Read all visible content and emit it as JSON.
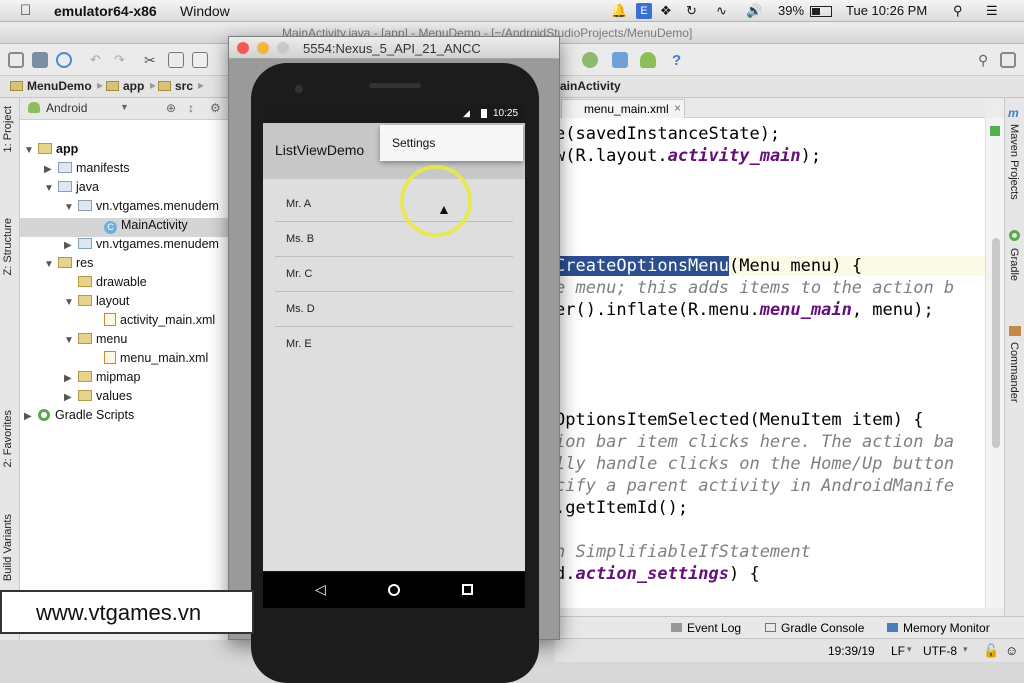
{
  "menubar": {
    "app_name": "emulator64-x86",
    "menu_window": "Window",
    "battery": "39%",
    "clock": "Tue 10:26 PM"
  },
  "studio": {
    "title": "MainActivity.java - [app] - MenuDemo - [~/AndroidStudioProjects/MenuDemo]",
    "breadcrumbs": [
      "MenuDemo",
      "app",
      "src"
    ],
    "crumb_tail": "ainActivity",
    "project_view": "Android",
    "tree": [
      {
        "label": "app",
        "level": 0
      },
      {
        "label": "manifests",
        "level": 1
      },
      {
        "label": "java",
        "level": 1
      },
      {
        "label": "vn.vtgames.menudem",
        "level": 2
      },
      {
        "label": "MainActivity",
        "level": 3
      },
      {
        "label": "vn.vtgames.menudem",
        "level": 2
      },
      {
        "label": "res",
        "level": 1
      },
      {
        "label": "drawable",
        "level": 2
      },
      {
        "label": "layout",
        "level": 2
      },
      {
        "label": "activity_main.xml",
        "level": 3
      },
      {
        "label": "menu",
        "level": 2
      },
      {
        "label": "menu_main.xml",
        "level": 3
      },
      {
        "label": "mipmap",
        "level": 2
      },
      {
        "label": "values",
        "level": 2
      },
      {
        "label": "Gradle Scripts",
        "level": 0
      }
    ],
    "left_tools": [
      "1: Project",
      "Z: Structure",
      "2: Favorites",
      "Build Variants"
    ],
    "right_tools": [
      "Maven Projects",
      "Gradle",
      "Commander"
    ],
    "editor_tab": "menu_main.xml",
    "code": {
      "l1": "e(savedInstanceState);",
      "l2a": "w(R.layout.",
      "l2b": "activity_main",
      "l2c": ");",
      "l3a": "CreateOptionsMenu",
      "l3b": "(Menu menu) {",
      "l4": "e menu; this adds items to the action b",
      "l5a": "er().inflate(R.menu.",
      "l5b": "menu_main",
      "l5c": ", menu);",
      "l6": "OptionsItemSelected(MenuItem item) {",
      "l7": "ion bar item clicks here. The action ba",
      "l8": "lly handle clicks on the Home/Up button",
      "l9": "cify a parent activity in AndroidManife",
      "l10": ".getItemId();",
      "l11": "n SimplifiableIfStatement",
      "l12a": "d.",
      "l12b": "action_settings",
      "l12c": ") {"
    },
    "bottom_tools": [
      "Event Log",
      "Gradle Console",
      "Memory Monitor"
    ],
    "status": {
      "position": "19:39/19",
      "line_sep": "LF",
      "encoding": "UTF-8"
    }
  },
  "emulator": {
    "title": "5554:Nexus_5_API_21_ANCC",
    "time": "10:25",
    "app_title": "ListViewDemo",
    "menu_item": "Settings",
    "list": [
      "Mr. A",
      "Ms. B",
      "Mr. C",
      "Ms. D",
      "Mr. E"
    ]
  },
  "watermark": "www.vtgames.vn"
}
